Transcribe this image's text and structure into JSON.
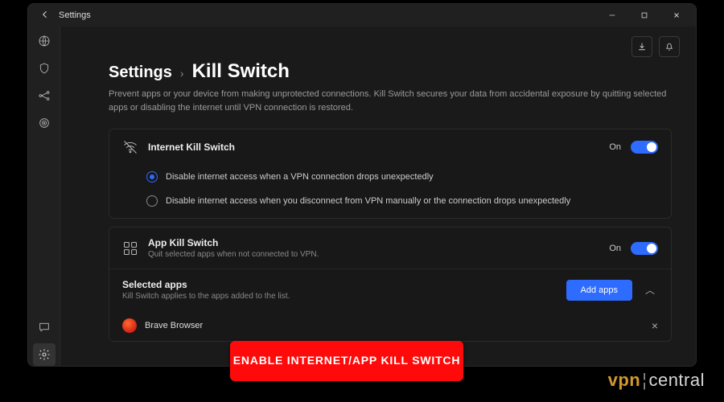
{
  "titlebar": {
    "title": "Settings"
  },
  "topicons": {
    "download": "⤓",
    "bell": "△"
  },
  "breadcrumb": {
    "parent": "Settings",
    "sep": "›",
    "current": "Kill Switch"
  },
  "description": "Prevent apps or your device from making unprotected connections. Kill Switch secures your data from accidental exposure by quitting selected apps or disabling the internet until VPN connection is restored.",
  "internet_switch": {
    "title": "Internet Kill Switch",
    "state": "On",
    "options": [
      {
        "label": "Disable internet access when a VPN connection drops unexpectedly",
        "selected": true
      },
      {
        "label": "Disable internet access when you disconnect from VPN manually or the connection drops unexpectedly",
        "selected": false
      }
    ]
  },
  "app_switch": {
    "title": "App Kill Switch",
    "subtitle": "Quit selected apps when not connected to VPN.",
    "state": "On",
    "selected_apps_title": "Selected apps",
    "selected_apps_sub": "Kill Switch applies to the apps added to the list.",
    "add_button": "Add apps",
    "apps": [
      {
        "name": "Brave Browser"
      }
    ]
  },
  "annotation": "Enable Internet/App kill switch",
  "watermark": {
    "left": "vpn",
    "right": "central"
  }
}
